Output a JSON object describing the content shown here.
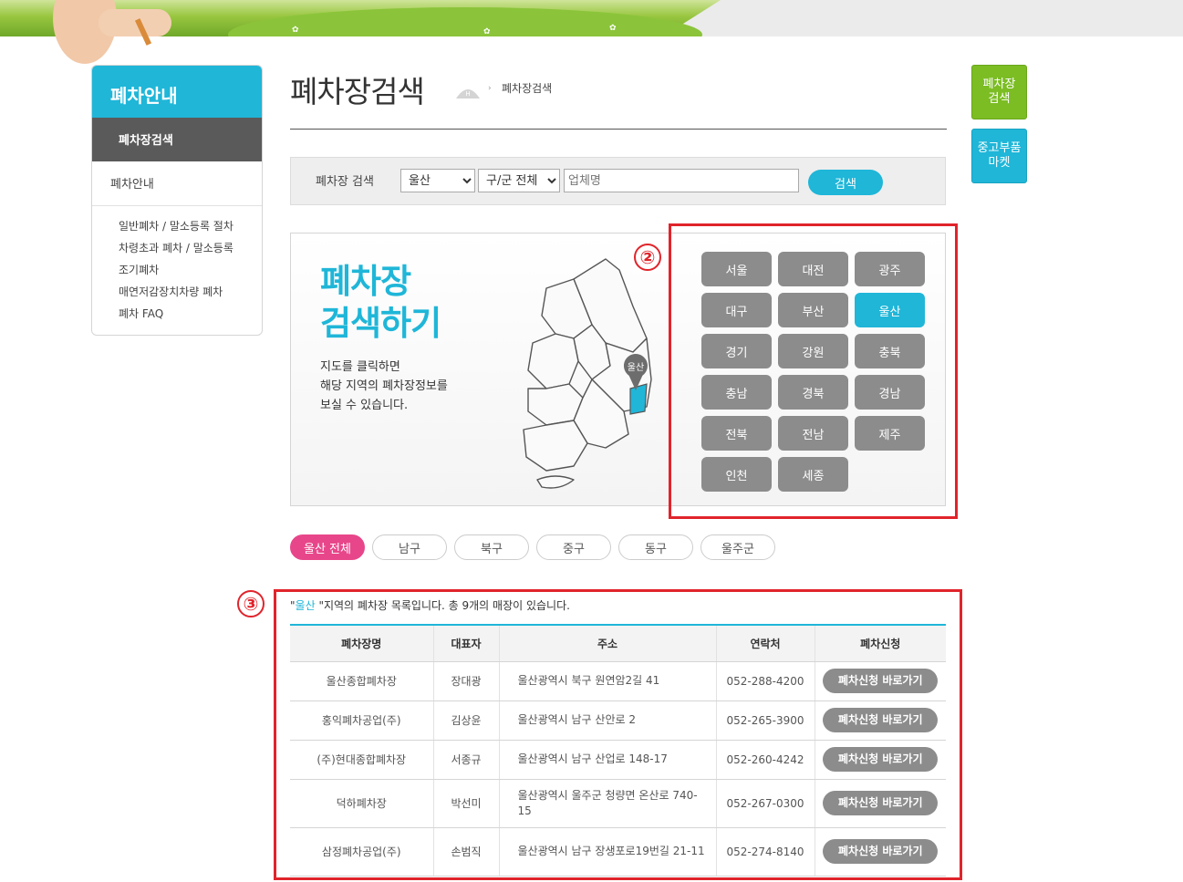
{
  "sidebar": {
    "title": "폐차안내",
    "active": "폐차장검색",
    "item": "폐차안내",
    "sub_items": [
      "일반폐차 / 말소등록 절차",
      "차령초과 폐차 / 말소등록",
      "조기폐차",
      "매연저감장치차량 폐차",
      "폐차 FAQ"
    ]
  },
  "header": {
    "title": "폐차장검색",
    "breadcrumb": "폐차장검색"
  },
  "quick": {
    "search": "폐차장 검색",
    "market": "중고부품 마켓"
  },
  "search": {
    "label": "폐차장 검색",
    "city": "울산",
    "district": "구/군 전체",
    "placeholder": "업체명",
    "button": "검색"
  },
  "map": {
    "heading_line1": "폐차장",
    "heading_line2": "검색하기",
    "desc_line1": "지도를 클릭하면",
    "desc_line2": "해당 지역의 폐차장정보를",
    "desc_line3": "보실 수 있습니다.",
    "pin_label": "울산",
    "regions": [
      "서울",
      "대전",
      "광주",
      "대구",
      "부산",
      "울산",
      "경기",
      "강원",
      "충북",
      "충남",
      "경북",
      "경남",
      "전북",
      "전남",
      "제주",
      "인천",
      "세종"
    ],
    "active_region": "울산"
  },
  "annotations": {
    "two": "②",
    "three": "③"
  },
  "districts": [
    "울산 전체",
    "남구",
    "북구",
    "중구",
    "동구",
    "울주군"
  ],
  "results": {
    "caption_open": "\"",
    "caption_region": "울산",
    "caption_rest": " \"지역의 폐차장 목록입니다. 총 9개의 매장이 있습니다.",
    "headers": [
      "폐차장명",
      "대표자",
      "주소",
      "연락처",
      "폐차신청"
    ],
    "button_label": "폐차신청 바로가기",
    "rows": [
      {
        "name": "울산종합폐차장",
        "owner": "장대광",
        "address": "울산광역시 북구 원연암2길 41",
        "phone": "052-288-4200"
      },
      {
        "name": "홍익폐차공업(주)",
        "owner": "김상윤",
        "address": "울산광역시 남구 산안로 2",
        "phone": "052-265-3900"
      },
      {
        "name": "(주)현대종합폐차장",
        "owner": "서종규",
        "address": "울산광역시 남구 산업로 148-17",
        "phone": "052-260-4242"
      },
      {
        "name": "덕하폐차장",
        "owner": "박선미",
        "address": "울산광역시 울주군 청량면 온산로 740-15",
        "phone": "052-267-0300"
      },
      {
        "name": "삼정폐차공업(주)",
        "owner": "손범직",
        "address": "울산광역시 남구 장생포로19번길 21-11",
        "phone": "052-274-8140"
      }
    ]
  },
  "colors": {
    "accent": "#1fb6d8",
    "green": "#7bbd23",
    "pink": "#e8468a",
    "annotation": "#e0242b"
  }
}
